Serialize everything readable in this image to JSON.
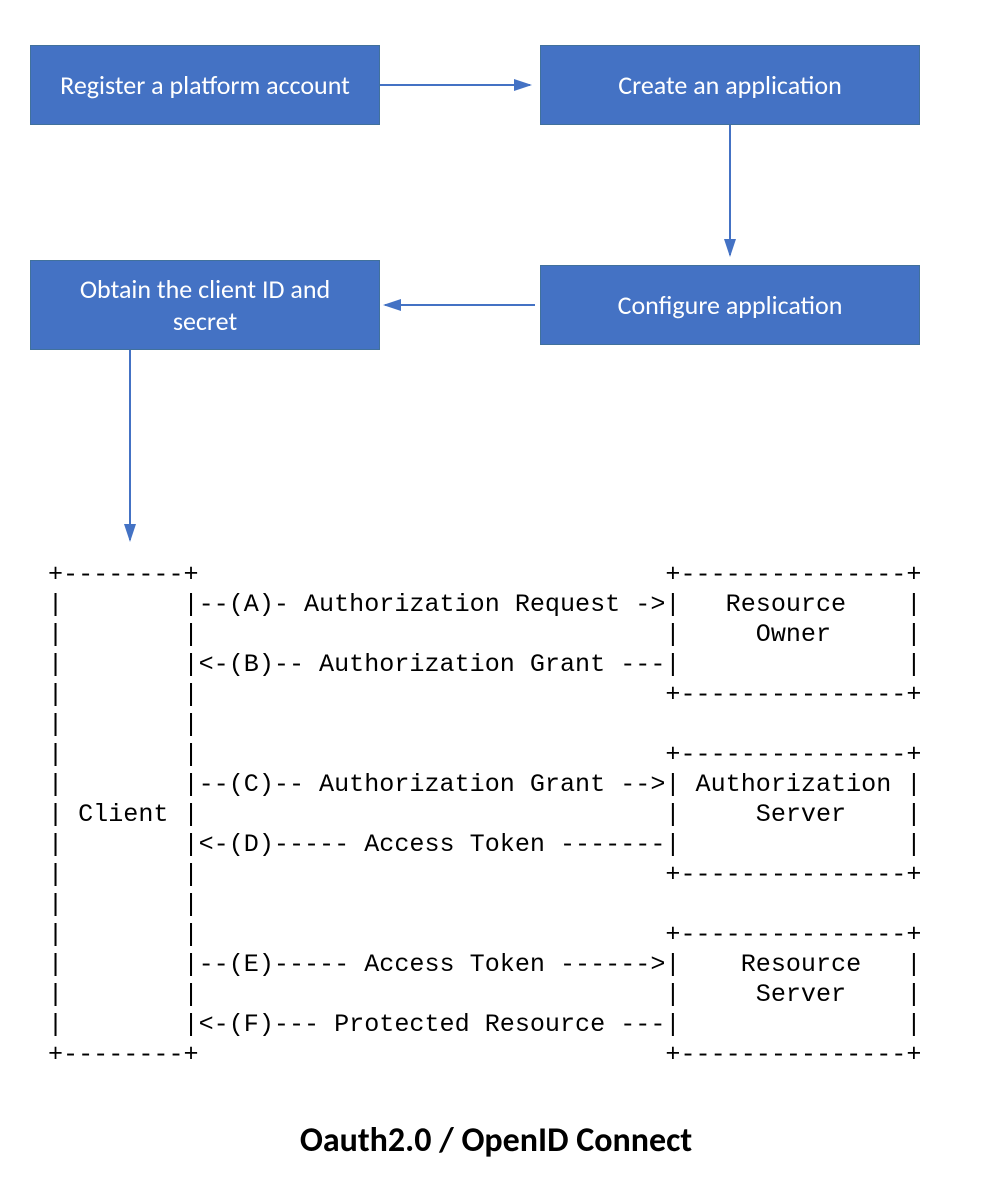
{
  "boxes": {
    "register": "Register a platform account",
    "create": "Create an application",
    "configure": "Configure application",
    "obtain": "Obtain the client ID and secret"
  },
  "ascii": "+--------+                               +---------------+\n|        |--(A)- Authorization Request ->|   Resource    |\n|        |                               |     Owner     |\n|        |<-(B)-- Authorization Grant ---|               |\n|        |                               +---------------+\n|        |\n|        |                               +---------------+\n|        |--(C)-- Authorization Grant -->| Authorization |\n| Client |                               |     Server    |\n|        |<-(D)----- Access Token -------|               |\n|        |                               +---------------+\n|        |\n|        |                               +---------------+\n|        |--(E)----- Access Token ------>|    Resource   |\n|        |                               |     Server    |\n|        |<-(F)--- Protected Resource ---|               |\n+--------+                               +---------------+",
  "caption": "Oauth2.0 / OpenID Connect",
  "colors": {
    "box_fill": "#4472c4",
    "box_border": "#41719c",
    "arrow": "#4472c4"
  },
  "chart_data": {
    "type": "diagram",
    "title": "Oauth2.0 / OpenID Connect",
    "setup_flow": [
      {
        "id": "register",
        "label": "Register a platform account"
      },
      {
        "id": "create",
        "label": "Create an application"
      },
      {
        "id": "configure",
        "label": "Configure application"
      },
      {
        "id": "obtain",
        "label": "Obtain the client ID and secret"
      }
    ],
    "setup_edges": [
      {
        "from": "register",
        "to": "create"
      },
      {
        "from": "create",
        "to": "configure"
      },
      {
        "from": "configure",
        "to": "obtain"
      },
      {
        "from": "obtain",
        "to": "oauth_protocol"
      }
    ],
    "oauth_actors": [
      "Client",
      "Resource Owner",
      "Authorization Server",
      "Resource Server"
    ],
    "oauth_messages": [
      {
        "step": "A",
        "from": "Client",
        "to": "Resource Owner",
        "label": "Authorization Request"
      },
      {
        "step": "B",
        "from": "Resource Owner",
        "to": "Client",
        "label": "Authorization Grant"
      },
      {
        "step": "C",
        "from": "Client",
        "to": "Authorization Server",
        "label": "Authorization Grant"
      },
      {
        "step": "D",
        "from": "Authorization Server",
        "to": "Client",
        "label": "Access Token"
      },
      {
        "step": "E",
        "from": "Client",
        "to": "Resource Server",
        "label": "Access Token"
      },
      {
        "step": "F",
        "from": "Resource Server",
        "to": "Client",
        "label": "Protected Resource"
      }
    ]
  }
}
